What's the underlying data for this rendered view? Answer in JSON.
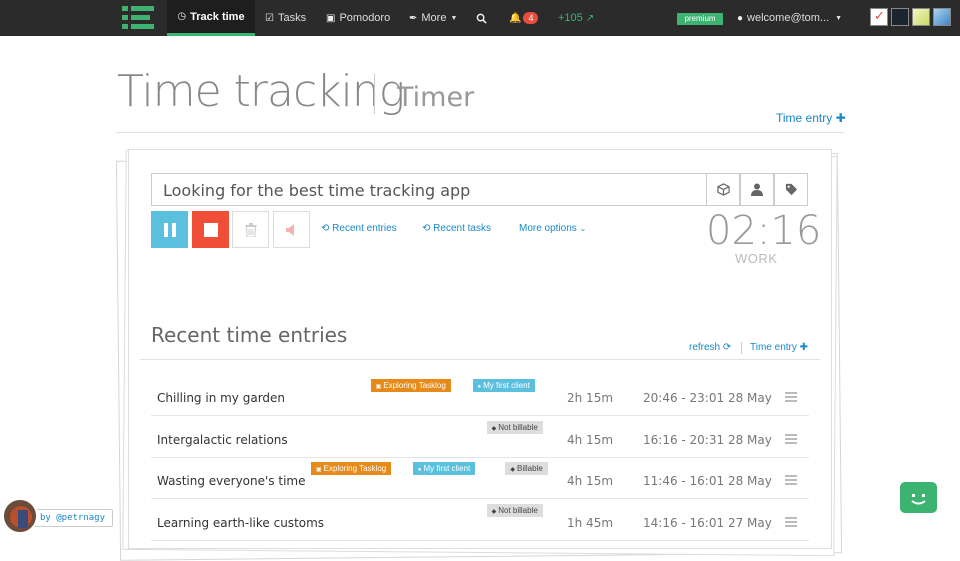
{
  "nav": {
    "track_time": "Track time",
    "tasks": "Tasks",
    "pomodoro": "Pomodoro",
    "more": "More",
    "notifications_count": "4",
    "points": "+105",
    "premium": "premium",
    "user": "welcome@tom..."
  },
  "header": {
    "title": "Time tracking",
    "subtitle": "Timer",
    "time_entry_link": "Time entry"
  },
  "timer": {
    "task_value": "Looking for the best time tracking app",
    "recent_entries": "Recent entries",
    "recent_tasks": "Recent tasks",
    "more_options": "More options",
    "clock": "02:16",
    "mode": "WORK"
  },
  "recent": {
    "title": "Recent time entries",
    "refresh": "refresh",
    "time_entry": "Time entry",
    "entries": [
      {
        "name": "Chilling in my garden",
        "duration": "2h 15m",
        "range": "20:46 - 23:01 28 May",
        "tags": [
          {
            "label": "Exploring Tasklog",
            "kind": "orange"
          },
          {
            "label": "My first client",
            "kind": "blue"
          }
        ]
      },
      {
        "name": "Intergalactic relations",
        "duration": "4h 15m",
        "range": "16:16 - 20:31 28 May",
        "tags": [
          {
            "label": "Not billable",
            "kind": "grey"
          }
        ]
      },
      {
        "name": "Wasting everyone's time",
        "duration": "4h 15m",
        "range": "11:46 - 16:01 28 May",
        "tags": [
          {
            "label": "Exploring Tasklog",
            "kind": "orange"
          },
          {
            "label": "My first client",
            "kind": "blue"
          },
          {
            "label": "Billable",
            "kind": "grey"
          }
        ]
      },
      {
        "name": "Learning earth-like customs",
        "duration": "1h 45m",
        "range": "14:16 - 16:01 27 May",
        "tags": [
          {
            "label": "Not billable",
            "kind": "grey"
          }
        ]
      }
    ]
  },
  "footer": {
    "byline": "by @petrnagy"
  },
  "colors": {
    "brand_green": "#3cb371",
    "link_blue": "#1a88c9",
    "pause_blue": "#5bc0de",
    "stop_red": "#f04e37",
    "tag_orange": "#e68a1a",
    "badge_red": "#e74c3c"
  }
}
